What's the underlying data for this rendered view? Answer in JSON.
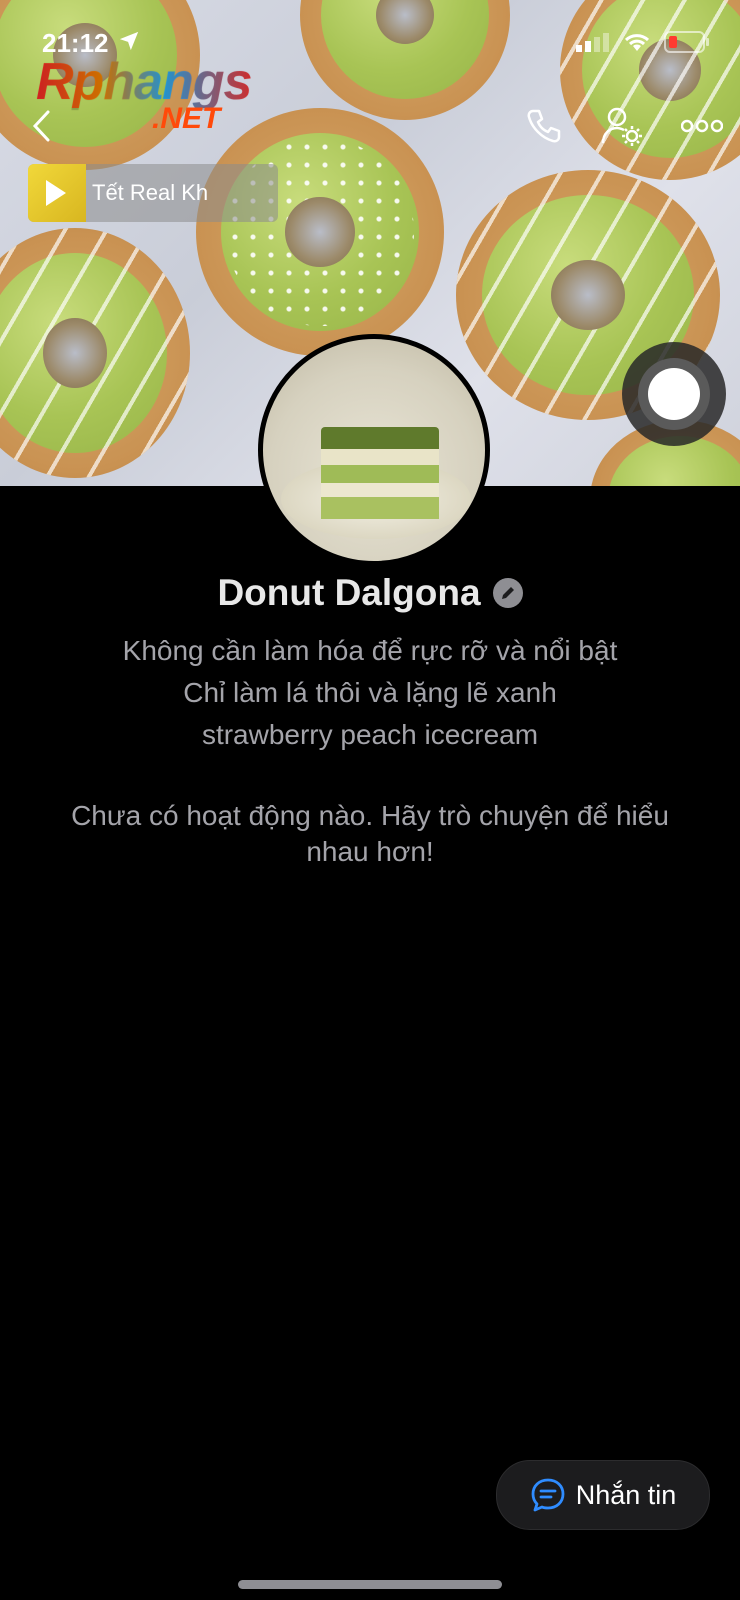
{
  "status_bar": {
    "time": "21:12"
  },
  "watermark": {
    "top": "Rphangs",
    "bottom": ".NET"
  },
  "music": {
    "title": "Tết Real Kh"
  },
  "profile": {
    "name": "Donut Dalgona",
    "bio": [
      "Không cần làm hóa để rực rỡ và nổi bật",
      "Chỉ làm lá thôi và lặng lẽ xanh",
      "strawberry peach icecream"
    ],
    "empty_activity": "Chưa có hoạt động nào. Hãy trò chuyện để hiểu nhau hơn!"
  },
  "actions": {
    "message_label": "Nhắn tin"
  },
  "colors": {
    "background": "#000000",
    "icing": "#a8c455",
    "accent_blue": "#2f8cff"
  }
}
